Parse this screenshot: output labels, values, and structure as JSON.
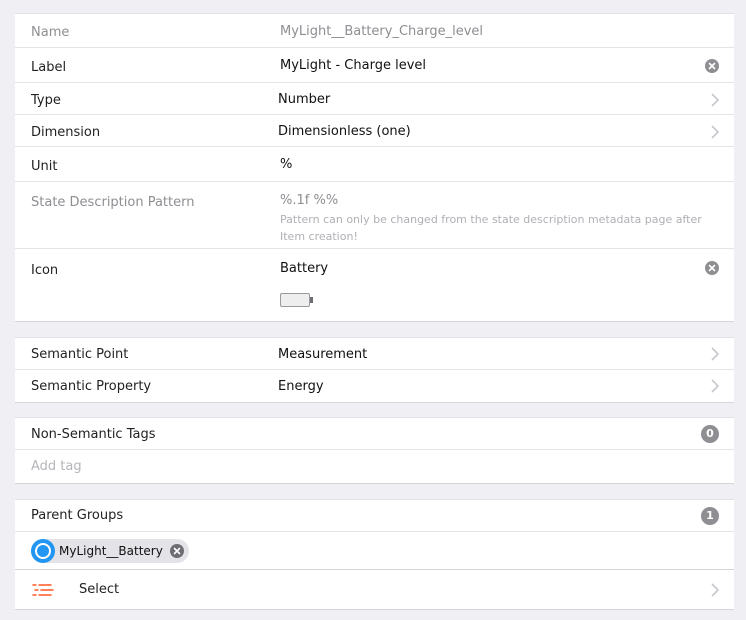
{
  "item": {
    "name_label": "Name",
    "name_value": "MyLight__Battery_Charge_level",
    "label_label": "Label",
    "label_value": "MyLight - Charge level",
    "type_label": "Type",
    "type_value": "Number",
    "dimension_label": "Dimension",
    "dimension_value": "Dimensionless (one)",
    "unit_label": "Unit",
    "unit_value": "%",
    "pattern_label": "State Description Pattern",
    "pattern_value": "%.1f %%",
    "pattern_hint": "Pattern can only be changed from the state description metadata page after Item creation!",
    "icon_label": "Icon",
    "icon_value": "Battery",
    "icon_preview": "battery-icon"
  },
  "semantics": {
    "point_label": "Semantic Point",
    "point_value": "Measurement",
    "property_label": "Semantic Property",
    "property_value": "Energy"
  },
  "tags": {
    "label": "Non-Semantic Tags",
    "count": "0",
    "add_placeholder": "Add tag"
  },
  "groups": {
    "label": "Parent Groups",
    "count": "1",
    "chips": [
      {
        "label": "MyLight__Battery",
        "icon": "folder-icon",
        "color": "#2196f3"
      }
    ],
    "select_label": "Select",
    "select_icon": "list-icon",
    "select_icon_color": "#ff5722"
  },
  "colors": {
    "background": "#efeff4",
    "muted_text": "#8e8e93",
    "badge": "#8e8e93",
    "chip_media": "#2196f3",
    "list_icon": "#ff5722"
  }
}
